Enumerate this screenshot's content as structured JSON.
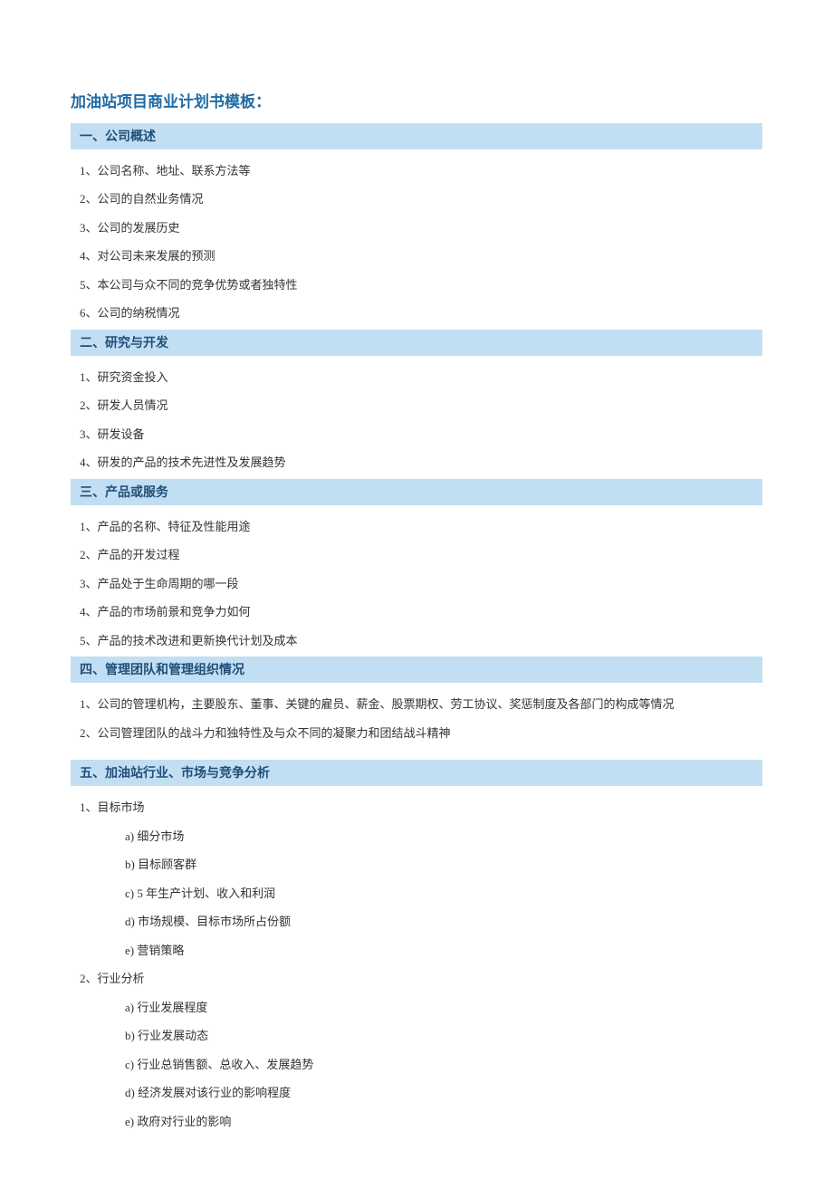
{
  "title": "加油站项目商业计划书模板：",
  "sections": [
    {
      "header": "一、公司概述",
      "items": [
        "1、公司名称、地址、联系方法等",
        "2、公司的自然业务情况",
        "3、公司的发展历史",
        "4、对公司未来发展的预测",
        "5、本公司与众不同的竞争优势或者独特性",
        "6、公司的纳税情况"
      ]
    },
    {
      "header": "二、研究与开发",
      "items": [
        "1、研究资金投入",
        "2、研发人员情况",
        "3、研发设备",
        "4、研发的产品的技术先进性及发展趋势"
      ]
    },
    {
      "header": "三、产品或服务",
      "items": [
        "1、产品的名称、特征及性能用途",
        "2、产品的开发过程",
        "3、产品处于生命周期的哪一段",
        "4、产品的市场前景和竞争力如何",
        "5、产品的技术改进和更新换代计划及成本"
      ]
    },
    {
      "header": "四、管理团队和管理组织情况",
      "items": [
        "1、公司的管理机构，主要股东、董事、关键的雇员、薪金、股票期权、劳工协议、奖惩制度及各部门的构成等情况",
        "2、公司管理团队的战斗力和独特性及与众不同的凝聚力和团结战斗精神"
      ]
    },
    {
      "header": "五、加油站行业、市场与竞争分析",
      "spacer_before": true,
      "groups": [
        {
          "label": "1、目标市场",
          "subitems": [
            "a)  细分市场",
            "b)  目标顾客群",
            "c) 5 年生产计划、收入和利润",
            "d)  市场规模、目标市场所占份额",
            "e)  营销策略"
          ]
        },
        {
          "label": "2、行业分析",
          "subitems": [
            "a)  行业发展程度",
            "b)  行业发展动态",
            "c)  行业总销售额、总收入、发展趋势",
            "d)  经济发展对该行业的影响程度",
            "e)  政府对行业的影响"
          ]
        }
      ]
    }
  ]
}
